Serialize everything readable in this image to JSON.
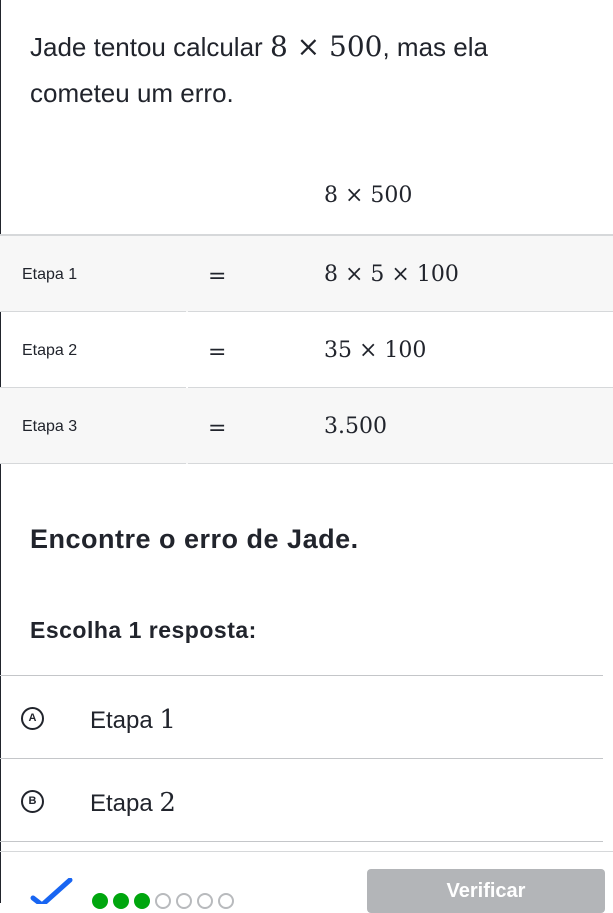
{
  "question": {
    "prefix": "Jade tentou calcular ",
    "expression": "8 × 500",
    "suffix": ", mas ela cometeu um erro."
  },
  "work": {
    "start_expression": "8 × 500",
    "steps": [
      {
        "label": "Etapa 1",
        "equals": "=",
        "expression": "8 × 5 × 100"
      },
      {
        "label": "Etapa 2",
        "equals": "=",
        "expression": "35 × 100"
      },
      {
        "label": "Etapa 3",
        "equals": "=",
        "expression": "3.500"
      }
    ]
  },
  "prompt": "Encontre o erro de Jade.",
  "choose_label": "Escolha 1 resposta:",
  "choices": [
    {
      "letter": "A",
      "text": "Etapa ",
      "number": "1"
    },
    {
      "letter": "B",
      "text": "Etapa ",
      "number": "2"
    }
  ],
  "footer": {
    "verify_label": "Verificar",
    "progress": {
      "completed": 3,
      "total": 7
    },
    "colors": {
      "progress_done": "#00a60e",
      "check": "#1865f2",
      "button_disabled": "#b3b5b8"
    }
  }
}
